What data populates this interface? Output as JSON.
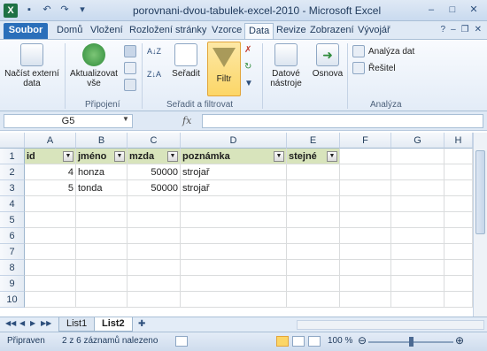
{
  "window": {
    "title": "porovnani-dvou-tabulek-excel-2010  -  Microsoft Excel",
    "app_icon": "X"
  },
  "qat": [
    "save-icon",
    "undo-icon",
    "redo-icon",
    "customize-icon"
  ],
  "tabs": {
    "file": "Soubor",
    "items": [
      "Domů",
      "Vložení",
      "Rozložení stránky",
      "Vzorce",
      "Data",
      "Revize",
      "Zobrazení",
      "Vývojář"
    ],
    "active": "Data"
  },
  "ribbon": {
    "nacist": "Načíst externí data",
    "aktualizovat": "Aktualizovat vše",
    "pripojeni_label": "Připojení",
    "seradit": "Seřadit",
    "filtr": "Filtr",
    "seradit_filtrovat_label": "Seřadit a filtrovat",
    "datove": "Datové nástroje",
    "osnova": "Osnova",
    "analyza_dat": "Analýza dat",
    "resitel": "Řešitel",
    "analyza_label": "Analýza",
    "sort_az": "A↓Z",
    "sort_za": "Z↓A"
  },
  "formula": {
    "namebox": "G5",
    "fx": "fx",
    "value": ""
  },
  "grid": {
    "columns": [
      "A",
      "B",
      "C",
      "D",
      "E",
      "F",
      "G",
      "H"
    ],
    "rows": [
      "1",
      "2",
      "3",
      "4",
      "5",
      "6",
      "7",
      "8",
      "9",
      "10"
    ],
    "header": [
      "id",
      "jméno",
      "mzda",
      "poznámka",
      "stejné"
    ],
    "data": [
      [
        "4",
        "honza",
        "50000",
        "strojař",
        ""
      ],
      [
        "5",
        "tonda",
        "50000",
        "strojař",
        ""
      ]
    ]
  },
  "sheets": {
    "tabs": [
      "List1",
      "List2"
    ],
    "active": "List2"
  },
  "status": {
    "ready": "Připraven",
    "records": "2 z 6 záznamů nalezeno",
    "zoom": "100 %"
  },
  "colors": {
    "header_fill": "#d8e4bc",
    "file_tab": "#2a6fba",
    "filter_highlight": "#fcd667"
  }
}
